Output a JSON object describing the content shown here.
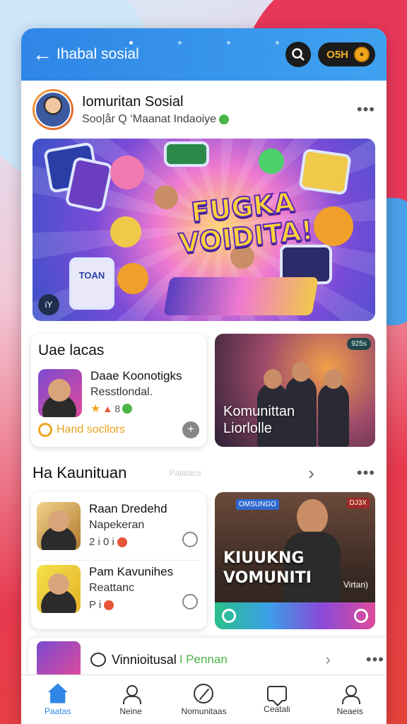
{
  "header": {
    "title": "Ihabal sosial",
    "coins": "O5H"
  },
  "profile": {
    "name": "Iomuritan Sosial",
    "subtitle": "Soo|år  Q  ‘Maanat Indaoiye"
  },
  "banner": {
    "headline_line1": "FUGKA",
    "headline_line2": "VOIDITA!",
    "tablet_text": "TOAN",
    "badge": "iY"
  },
  "ideas_card": {
    "title": "Uae lacas",
    "item_title": "Daae Koonotigks",
    "item_subtitle": "Resstlondal.",
    "item_meta": "8",
    "footer_text": "Hand socllors"
  },
  "community_card": {
    "label_line1": "Komunittan",
    "label_line2": "Liorlolle",
    "tag": "925s"
  },
  "section": {
    "title": "Ha Kaunituan",
    "hint": "Palalacs"
  },
  "list": [
    {
      "title": "Raan Dredehd",
      "subtitle": "Napekeran",
      "meta": "2 i 0 i"
    },
    {
      "title": "Pam Kavunihes",
      "subtitle": "Reattanc",
      "meta": "P i"
    }
  ],
  "feature": {
    "title_line1": "KIUUKNG",
    "title_line2": "VOMUNITI",
    "small_text": "Virtan)",
    "tag1": "OMSUNGO",
    "tag2": "DJ3X"
  },
  "bottom_card": {
    "text": "Vinnioitusal",
    "subtext": "I Pennan"
  },
  "nav": [
    {
      "label": "Paatas"
    },
    {
      "label": "Neine"
    },
    {
      "label": "Nomunitaas"
    },
    {
      "label": "Ceatali"
    },
    {
      "label": "Neaeis"
    }
  ]
}
